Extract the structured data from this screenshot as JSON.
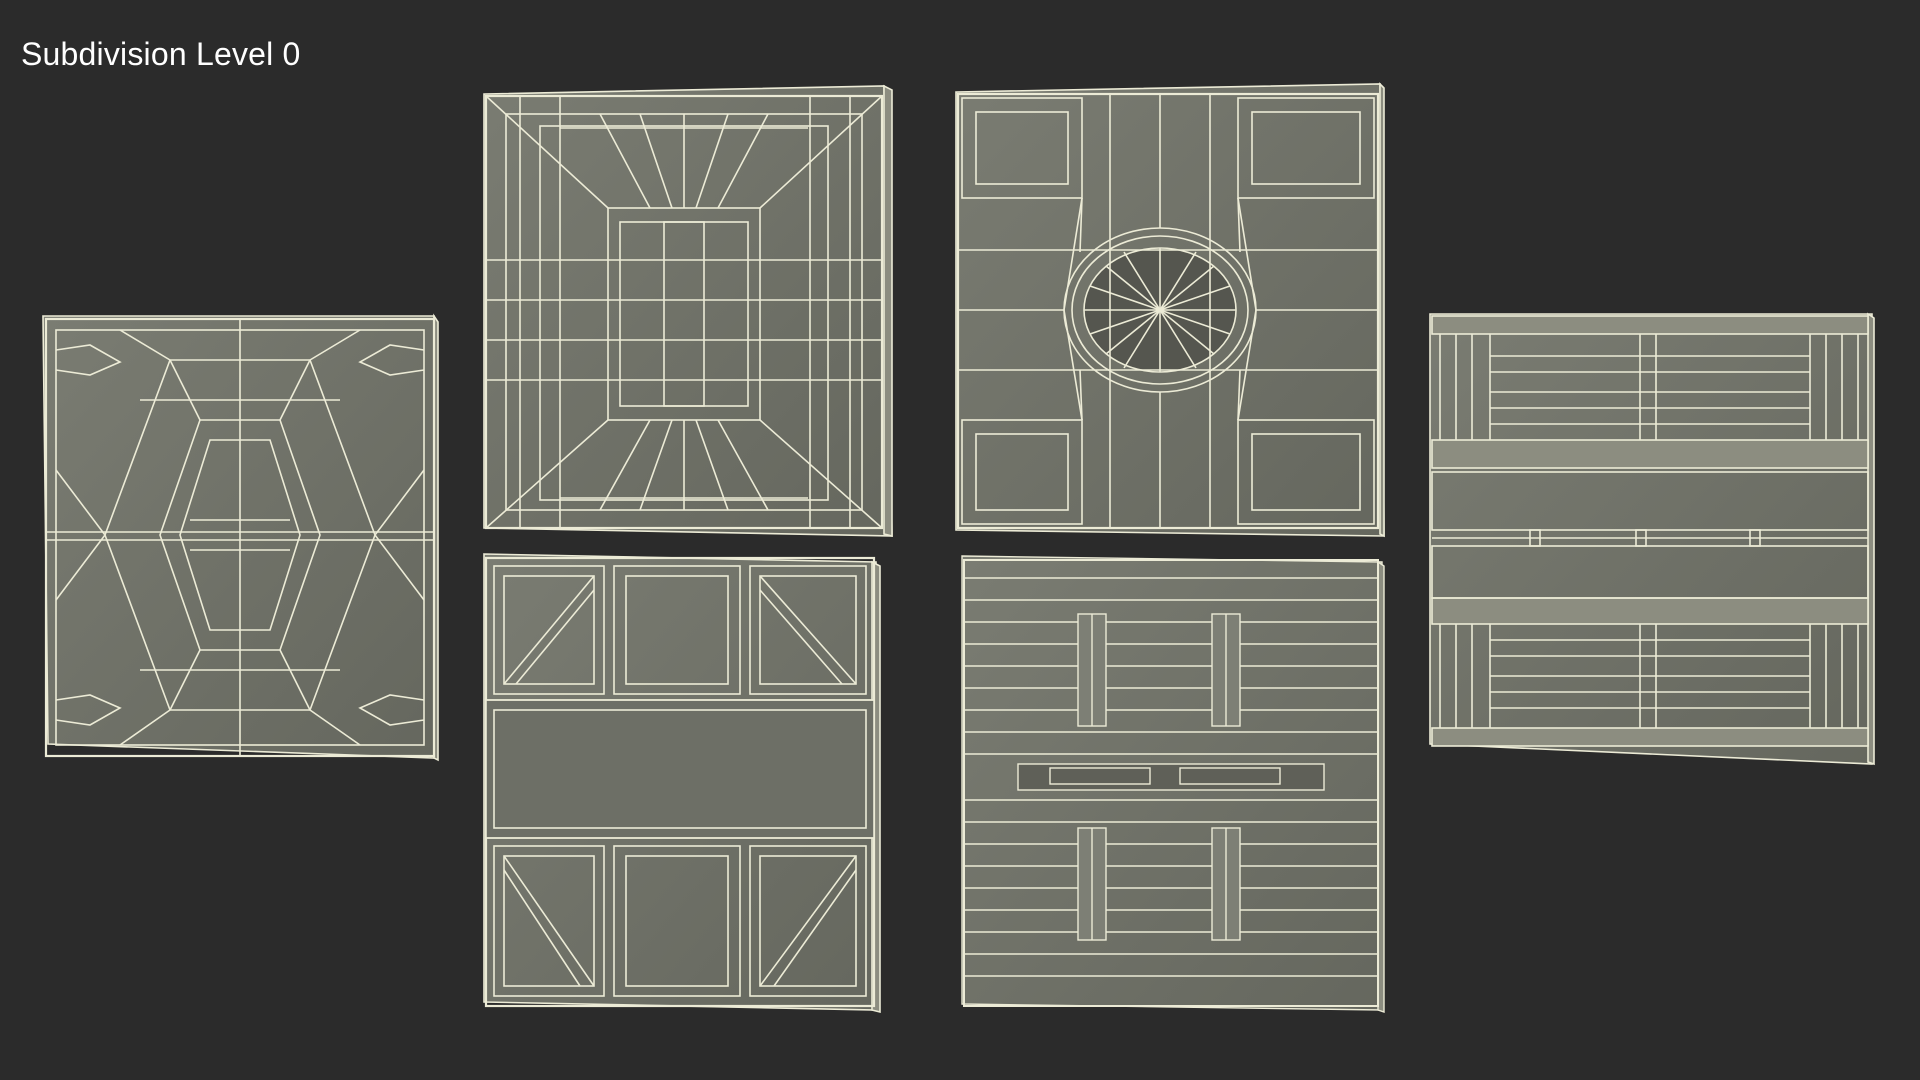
{
  "caption": {
    "text": "Subdivision Level 0"
  },
  "viewport": {
    "background": "#2b2b2b"
  },
  "material": {
    "fill": "#707268",
    "wire": "#ecebd6",
    "side": "#8c8d80",
    "shade": "#5c5d55"
  },
  "panels": [
    {
      "pattern": "hex-diamond"
    },
    {
      "pattern": "recessed-pyramid"
    },
    {
      "pattern": "round-vent"
    },
    {
      "pattern": "pipe-rack"
    },
    {
      "pattern": "truss-frame"
    },
    {
      "pattern": "tube-stack"
    }
  ]
}
